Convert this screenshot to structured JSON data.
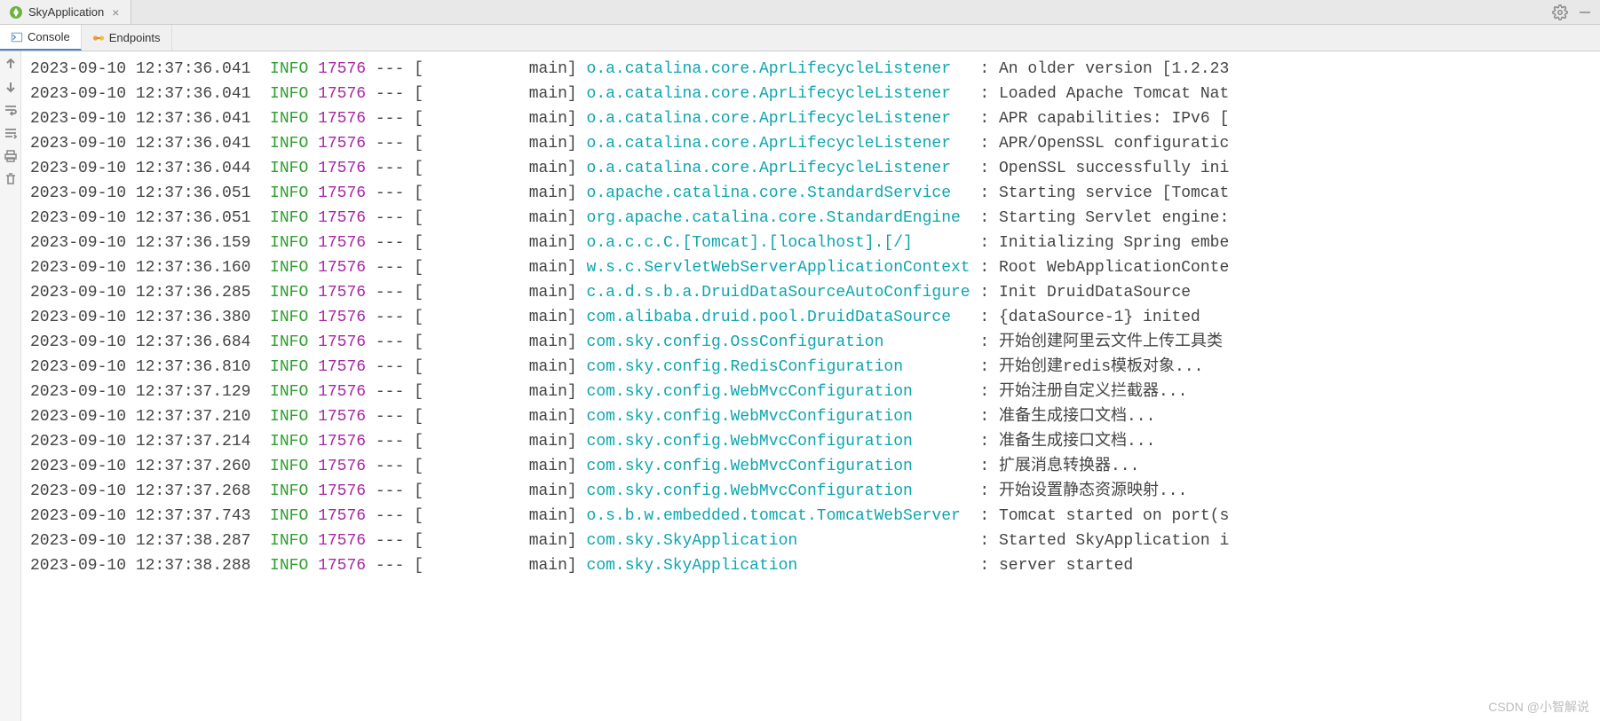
{
  "topTab": {
    "title": "SkyApplication",
    "closeGlyph": "×"
  },
  "topActions": {
    "gear": "gear-icon",
    "min": "minimize-icon"
  },
  "secondaryTabs": [
    {
      "key": "console",
      "label": "Console",
      "active": true
    },
    {
      "key": "endpoints",
      "label": "Endpoints",
      "active": false
    }
  ],
  "log": {
    "level": " INFO ",
    "pid": "17576",
    "lines": [
      {
        "ts": "2023-09-10 12:37:36.041",
        "thread": "           main",
        "logger": "o.a.catalina.core.AprLifecycleListener   ",
        "msg": " An older version [1.2.23"
      },
      {
        "ts": "2023-09-10 12:37:36.041",
        "thread": "           main",
        "logger": "o.a.catalina.core.AprLifecycleListener   ",
        "msg": " Loaded Apache Tomcat Nat"
      },
      {
        "ts": "2023-09-10 12:37:36.041",
        "thread": "           main",
        "logger": "o.a.catalina.core.AprLifecycleListener   ",
        "msg": " APR capabilities: IPv6 ["
      },
      {
        "ts": "2023-09-10 12:37:36.041",
        "thread": "           main",
        "logger": "o.a.catalina.core.AprLifecycleListener   ",
        "msg": " APR/OpenSSL configuratic"
      },
      {
        "ts": "2023-09-10 12:37:36.044",
        "thread": "           main",
        "logger": "o.a.catalina.core.AprLifecycleListener   ",
        "msg": " OpenSSL successfully ini"
      },
      {
        "ts": "2023-09-10 12:37:36.051",
        "thread": "           main",
        "logger": "o.apache.catalina.core.StandardService   ",
        "msg": " Starting service [Tomcat"
      },
      {
        "ts": "2023-09-10 12:37:36.051",
        "thread": "           main",
        "logger": "org.apache.catalina.core.StandardEngine  ",
        "msg": " Starting Servlet engine:"
      },
      {
        "ts": "2023-09-10 12:37:36.159",
        "thread": "           main",
        "logger": "o.a.c.c.C.[Tomcat].[localhost].[/]       ",
        "msg": " Initializing Spring embe"
      },
      {
        "ts": "2023-09-10 12:37:36.160",
        "thread": "           main",
        "logger": "w.s.c.ServletWebServerApplicationContext ",
        "msg": " Root WebApplicationConte"
      },
      {
        "ts": "2023-09-10 12:37:36.285",
        "thread": "           main",
        "logger": "c.a.d.s.b.a.DruidDataSourceAutoConfigure ",
        "msg": " Init DruidDataSource"
      },
      {
        "ts": "2023-09-10 12:37:36.380",
        "thread": "           main",
        "logger": "com.alibaba.druid.pool.DruidDataSource   ",
        "msg": " {dataSource-1} inited"
      },
      {
        "ts": "2023-09-10 12:37:36.684",
        "thread": "           main",
        "logger": "com.sky.config.OssConfiguration          ",
        "msg": " 开始创建阿里云文件上传工具类"
      },
      {
        "ts": "2023-09-10 12:37:36.810",
        "thread": "           main",
        "logger": "com.sky.config.RedisConfiguration        ",
        "msg": " 开始创建redis模板对象..."
      },
      {
        "ts": "2023-09-10 12:37:37.129",
        "thread": "           main",
        "logger": "com.sky.config.WebMvcConfiguration       ",
        "msg": " 开始注册自定义拦截器..."
      },
      {
        "ts": "2023-09-10 12:37:37.210",
        "thread": "           main",
        "logger": "com.sky.config.WebMvcConfiguration       ",
        "msg": " 准备生成接口文档..."
      },
      {
        "ts": "2023-09-10 12:37:37.214",
        "thread": "           main",
        "logger": "com.sky.config.WebMvcConfiguration       ",
        "msg": " 准备生成接口文档..."
      },
      {
        "ts": "2023-09-10 12:37:37.260",
        "thread": "           main",
        "logger": "com.sky.config.WebMvcConfiguration       ",
        "msg": " 扩展消息转换器..."
      },
      {
        "ts": "2023-09-10 12:37:37.268",
        "thread": "           main",
        "logger": "com.sky.config.WebMvcConfiguration       ",
        "msg": " 开始设置静态资源映射..."
      },
      {
        "ts": "2023-09-10 12:37:37.743",
        "thread": "           main",
        "logger": "o.s.b.w.embedded.tomcat.TomcatWebServer  ",
        "msg": " Tomcat started on port(s"
      },
      {
        "ts": "2023-09-10 12:37:38.287",
        "thread": "           main",
        "logger": "com.sky.SkyApplication                   ",
        "msg": " Started SkyApplication i"
      },
      {
        "ts": "2023-09-10 12:37:38.288",
        "thread": "           main",
        "logger": "com.sky.SkyApplication                   ",
        "msg": " server started"
      }
    ]
  },
  "watermark": "CSDN @小智解说"
}
